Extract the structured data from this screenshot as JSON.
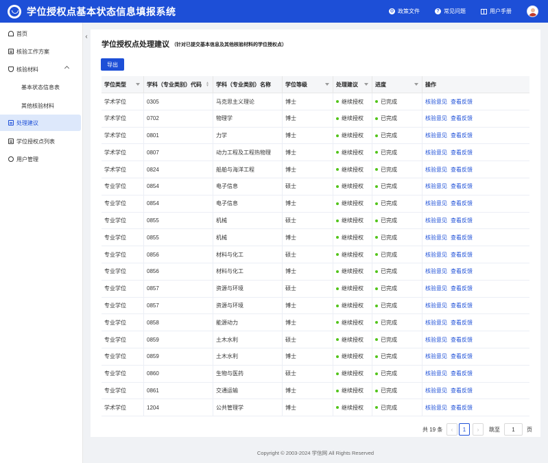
{
  "header": {
    "title": "学位授权点基本状态信息填报系统",
    "links": [
      {
        "icon": "gear-icon",
        "label": "政策文件"
      },
      {
        "icon": "question-icon",
        "label": "常见问题"
      },
      {
        "icon": "book-icon",
        "label": "用户手册"
      }
    ]
  },
  "sidebar": {
    "items": [
      {
        "label": "首页"
      },
      {
        "label": "核验工作方案"
      },
      {
        "label": "核验材料"
      },
      {
        "label": "基本状态信息表"
      },
      {
        "label": "其他核验材料"
      },
      {
        "label": "处理建议"
      },
      {
        "label": "学位授权点列表"
      },
      {
        "label": "用户管理"
      }
    ]
  },
  "main": {
    "title": "学位授权点处理建议",
    "subtitle": "（针对已提交基本信息及其他核验材料的学位授权点）",
    "export_label": "导出"
  },
  "table": {
    "headers": [
      "学位类型",
      "学科（专业类别）代码",
      "学科（专业类别）名称",
      "学位等级",
      "处理建议",
      "进度",
      "操作"
    ],
    "op_labels": [
      "核验意见",
      "查看反馈"
    ],
    "rows": [
      [
        "学术学位",
        "0305",
        "马克思主义理论",
        "博士",
        "继续授权",
        "已完成"
      ],
      [
        "学术学位",
        "0702",
        "物理学",
        "博士",
        "继续授权",
        "已完成"
      ],
      [
        "学术学位",
        "0801",
        "力学",
        "博士",
        "继续授权",
        "已完成"
      ],
      [
        "学术学位",
        "0807",
        "动力工程及工程热物理",
        "博士",
        "继续授权",
        "已完成"
      ],
      [
        "学术学位",
        "0824",
        "船舶与海洋工程",
        "博士",
        "继续授权",
        "已完成"
      ],
      [
        "专业学位",
        "0854",
        "电子信息",
        "硕士",
        "继续授权",
        "已完成"
      ],
      [
        "专业学位",
        "0854",
        "电子信息",
        "博士",
        "继续授权",
        "已完成"
      ],
      [
        "专业学位",
        "0855",
        "机械",
        "硕士",
        "继续授权",
        "已完成"
      ],
      [
        "专业学位",
        "0855",
        "机械",
        "博士",
        "继续授权",
        "已完成"
      ],
      [
        "专业学位",
        "0856",
        "材料与化工",
        "硕士",
        "继续授权",
        "已完成"
      ],
      [
        "专业学位",
        "0856",
        "材料与化工",
        "博士",
        "继续授权",
        "已完成"
      ],
      [
        "专业学位",
        "0857",
        "资源与环境",
        "硕士",
        "继续授权",
        "已完成"
      ],
      [
        "专业学位",
        "0857",
        "资源与环境",
        "博士",
        "继续授权",
        "已完成"
      ],
      [
        "专业学位",
        "0858",
        "能源动力",
        "博士",
        "继续授权",
        "已完成"
      ],
      [
        "专业学位",
        "0859",
        "土木水利",
        "硕士",
        "继续授权",
        "已完成"
      ],
      [
        "专业学位",
        "0859",
        "土木水利",
        "博士",
        "继续授权",
        "已完成"
      ],
      [
        "专业学位",
        "0860",
        "生物与医药",
        "硕士",
        "继续授权",
        "已完成"
      ],
      [
        "专业学位",
        "0861",
        "交通运输",
        "博士",
        "继续授权",
        "已完成"
      ],
      [
        "学术学位",
        "1204",
        "公共管理学",
        "博士",
        "继续授权",
        "已完成"
      ]
    ]
  },
  "pagination": {
    "total": "共 19 条",
    "prev": "‹",
    "current": "1",
    "next": "›",
    "goto_label": "跳至",
    "goto_value": "1",
    "page_unit": "页"
  },
  "footer": {
    "copyright": "Copyright © 2003-2024 学信网 All Rights Reserved"
  },
  "colors": {
    "primary": "#1d4fd7",
    "success": "#52c41a"
  }
}
